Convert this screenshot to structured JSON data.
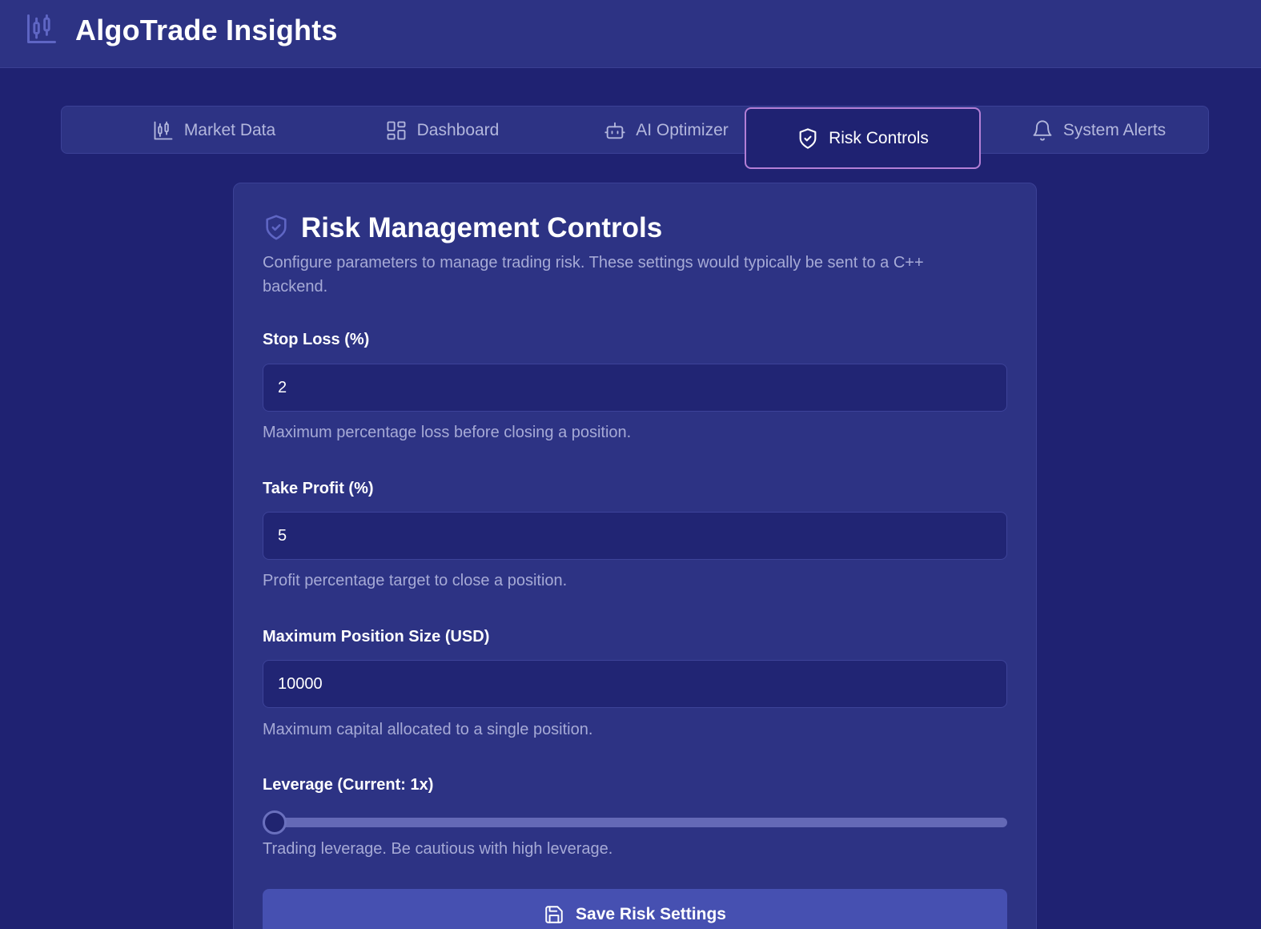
{
  "app": {
    "title": "AlgoTrade Insights",
    "logo_icon": "candlestick-chart-icon"
  },
  "tabs": [
    {
      "label": "Market Data",
      "icon": "candlestick-chart-icon",
      "active": false
    },
    {
      "label": "Dashboard",
      "icon": "dashboard-grid-icon",
      "active": false
    },
    {
      "label": "AI Optimizer",
      "icon": "robot-icon",
      "active": false
    },
    {
      "label": "Risk Controls",
      "icon": "shield-check-icon",
      "active": true
    },
    {
      "label": "System Alerts",
      "icon": "bell-icon",
      "active": false
    }
  ],
  "panel": {
    "title": "Risk Management Controls",
    "icon": "shield-check-icon",
    "description": "Configure parameters to manage trading risk. These settings would typically be sent to a C++ backend.",
    "fields": {
      "stop_loss": {
        "label": "Stop Loss (%)",
        "value": "2",
        "hint": "Maximum percentage loss before closing a position."
      },
      "take_profit": {
        "label": "Take Profit (%)",
        "value": "5",
        "hint": "Profit percentage target to close a position."
      },
      "max_position": {
        "label": "Maximum Position Size (USD)",
        "value": "10000",
        "hint": "Maximum capital allocated to a single position."
      },
      "leverage": {
        "label": "Leverage (Current: 1x)",
        "value": 1,
        "hint": "Trading leverage. Be cautious with high leverage."
      }
    },
    "save_button": {
      "label": "Save Risk Settings",
      "icon": "save-icon"
    }
  },
  "colors": {
    "background": "#1f2272",
    "surface": "#2d3384",
    "active_tab_border": "#b37fd6",
    "button": "#4650b1",
    "muted_text": "#a6aad6"
  }
}
